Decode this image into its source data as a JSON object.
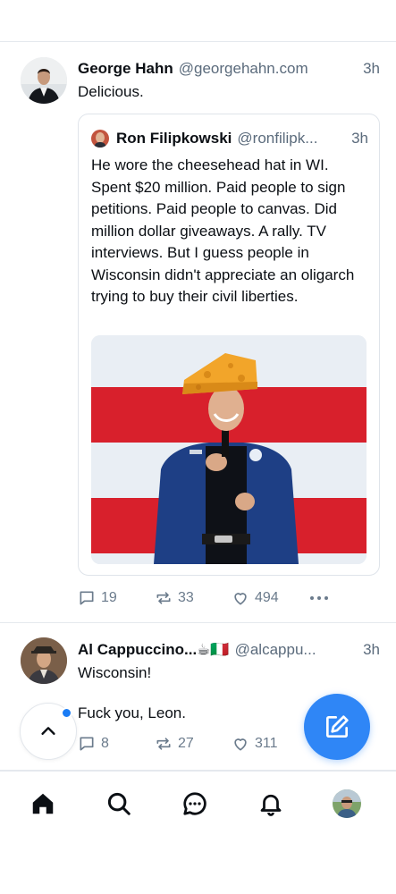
{
  "feed": {
    "posts": [
      {
        "author": "George Hahn",
        "handle": "@georgehahn.com",
        "time": "3h",
        "text": "Delicious.",
        "quote": {
          "author": "Ron Filipkowski",
          "handle": "@ronfilipk...",
          "time": "3h",
          "text": "He wore the cheesehead hat in WI. Spent $20 million. Paid people to sign petitions. Paid people to canvas. Did million dollar giveaways. A rally. TV interviews. But I guess people in Wisconsin didn't appreciate an oligarch trying to buy their civil liberties."
        },
        "replies": "19",
        "reposts": "33",
        "likes": "494"
      },
      {
        "author": "Al Cappuccino...☕🇮🇹",
        "handle": "@alcappu...",
        "time": "3h",
        "text_line1": "Wisconsin!",
        "text_line2": "Fuck you, Leon.",
        "replies": "8",
        "reposts": "27",
        "likes": "311"
      }
    ]
  },
  "icons": {
    "reply": "speech-bubble-icon",
    "repost": "repost-arrows-icon",
    "like": "heart-icon",
    "more": "ellipsis-icon",
    "compose": "compose-pencil-icon",
    "scroll_top": "chevron-up-icon",
    "nav": [
      "home-icon",
      "search-icon",
      "chat-icon",
      "bell-icon",
      "avatar"
    ]
  },
  "colors": {
    "accent": "#2f86f6",
    "muted": "#6b7b8c",
    "dot": "#1a7cf5"
  }
}
